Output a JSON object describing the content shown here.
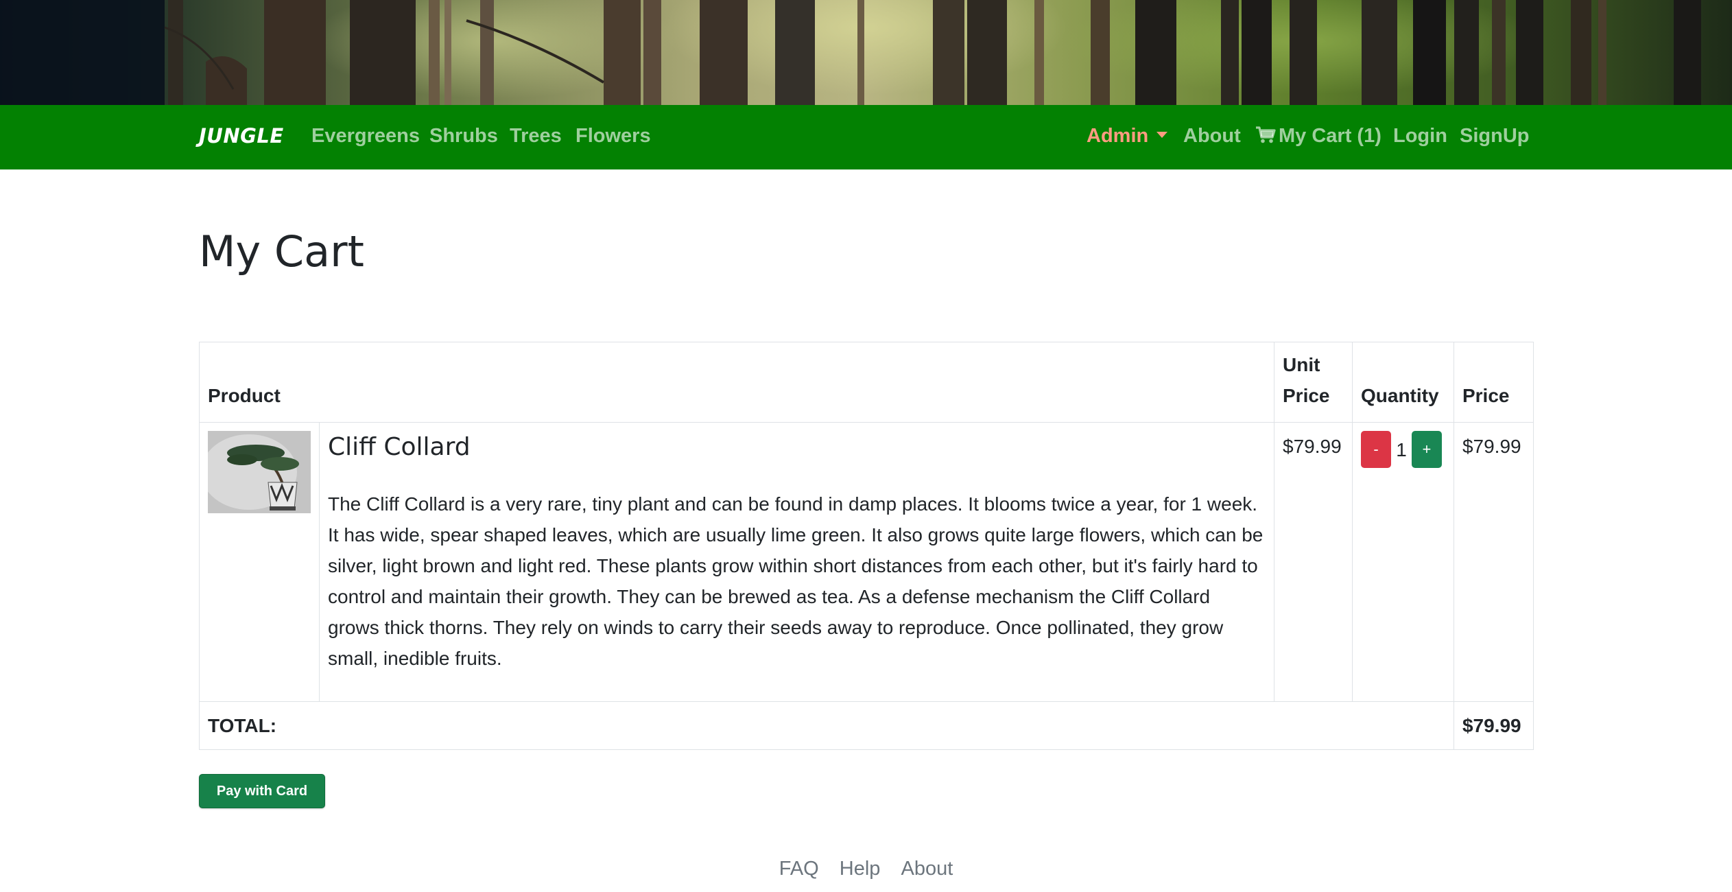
{
  "nav": {
    "brand": "JUNGLE",
    "left_links": [
      "Evergreens",
      "Shrubs",
      "Trees",
      "Flowers"
    ],
    "admin": "Admin",
    "about": "About",
    "cart": "My Cart (1)",
    "login": "Login",
    "signup": "SignUp",
    "accent_color": "#038102",
    "admin_color": "#ff9c82"
  },
  "page": {
    "title": "My Cart"
  },
  "table": {
    "headers": {
      "product": "Product",
      "unit_price": "Unit Price",
      "quantity": "Quantity",
      "price": "Price"
    },
    "items": [
      {
        "name": "Cliff Collard",
        "description": "The Cliff Collard is a very rare, tiny plant and can be found in damp places. It blooms twice a year, for 1 week. It has wide, spear shaped leaves, which are usually lime green. It also grows quite large flowers, which can be silver, light brown and light red. These plants grow within short distances from each other, but it's fairly hard to control and maintain their growth. They can be brewed as tea. As a defense mechanism the Cliff Collard grows thick thorns. They rely on winds to carry their seeds away to reproduce. Once pollinated, they grow small, inedible fruits.",
        "unit_price": "$79.99",
        "minus_label": "-",
        "quantity": "1",
        "plus_label": "+",
        "price": "$79.99"
      }
    ],
    "total_label": "TOTAL:",
    "total_value": "$79.99"
  },
  "pay_button": "Pay with Card",
  "footer": {
    "links": [
      "FAQ",
      "Help",
      "About"
    ]
  }
}
